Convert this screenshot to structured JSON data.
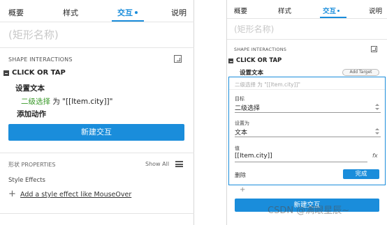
{
  "left_panel": {
    "tabs": [
      {
        "label": "概要"
      },
      {
        "label": "样式"
      },
      {
        "label": "交互"
      },
      {
        "label": "说明"
      }
    ],
    "shape_name_placeholder": "(矩形名称)",
    "section_title": "SHAPE INTERACTIONS",
    "event": "CLICK OR TAP",
    "action": "设置文本",
    "target": "二级选择",
    "target_suffix": " 为 \"[[Item.city]]\"",
    "add_action": "添加动作",
    "new_interaction": "新建交互",
    "properties_title": "形状 PROPERTIES",
    "show_all": "Show All",
    "style_effects": "Style Effects",
    "add_style_effect_plus": "+",
    "add_style_effect": "Add a style effect like MouseOver"
  },
  "right_panel": {
    "tabs": [
      {
        "label": "概要"
      },
      {
        "label": "样式"
      },
      {
        "label": "交互"
      },
      {
        "label": "说明"
      }
    ],
    "shape_name_placeholder": "(矩形名称)",
    "section_title": "SHAPE INTERACTIONS",
    "event": "CLICK OR TAP",
    "action": "设置文本",
    "add_target": "Add Target",
    "editor_header": "二级选择 为 \"[[Item.city]]\"",
    "target_label": "目标",
    "target_value": "二级选择",
    "set_to_label": "设置为",
    "set_to_value": "文本",
    "value_label": "值",
    "value_value": "[[Item.city]]",
    "fx": "fx",
    "delete": "删除",
    "done": "完成",
    "plus": "+",
    "new_interaction": "新建交互"
  },
  "watermark": "CSDN @满眼星辰~",
  "colors": {
    "accent": "#1a8ddb",
    "green": "#3a9a2a",
    "placeholder": "#c8c8c8"
  }
}
